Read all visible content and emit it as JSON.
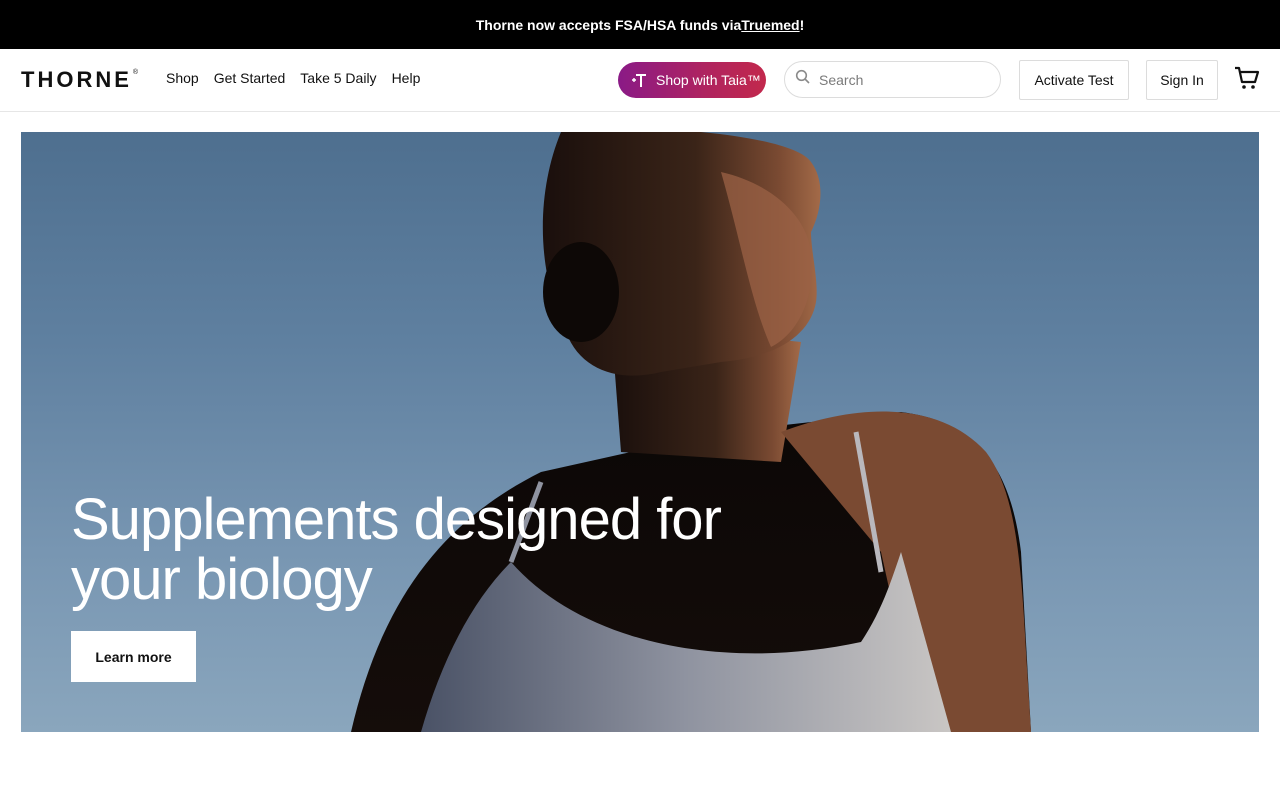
{
  "promo": {
    "text_before": "Thorne now accepts FSA/HSA funds via ",
    "link": "Truemed",
    "text_after": "!"
  },
  "header": {
    "logo": "THORNE",
    "logo_mark": "®",
    "nav": [
      "Shop",
      "Get Started",
      "Take 5 Daily",
      "Help"
    ],
    "taia_button": "Shop with Taia™",
    "search_placeholder": "Search",
    "activate_button": "Activate Test",
    "signin_button": "Sign In",
    "icons": {
      "taia": "sparkle-t-icon",
      "search": "search-icon",
      "cart": "cart-icon"
    }
  },
  "hero": {
    "title": "Supplements designed for your biology",
    "cta": "Learn more"
  },
  "colors": {
    "promo_bg": "#000000",
    "taia_gradient_start": "#8a1a86",
    "taia_gradient_end": "#c2284c",
    "hero_sky": "#6a8aa8"
  }
}
